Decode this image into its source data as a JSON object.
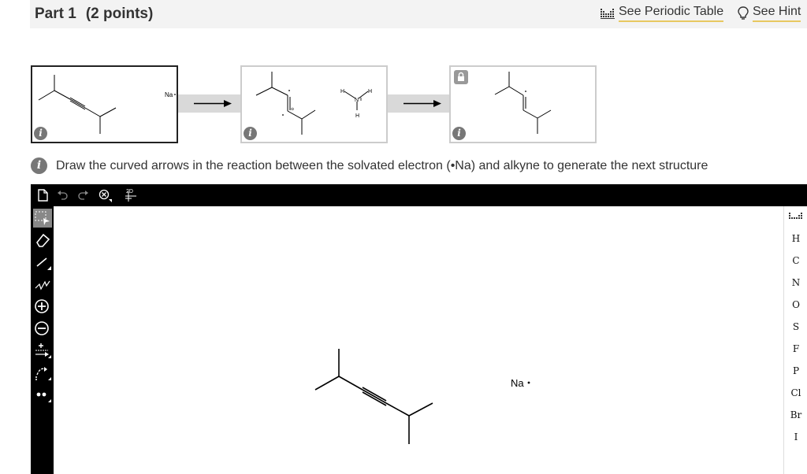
{
  "header": {
    "part": "Part 1",
    "points": "(2 points)",
    "periodic_table_link": "See Periodic Table",
    "hint_link": "See Hint"
  },
  "scheme": {
    "box1": {
      "sodium_label": "Na"
    },
    "box2": {
      "amine_labels": {
        "h_left": "H",
        "n": "N",
        "h_right": "H",
        "h_bottom": "H"
      }
    },
    "info_glyph": "i"
  },
  "instruction": {
    "text": "Draw the curved arrows in the reaction between the solvated electron (•Na) and alkyne to generate the next structure"
  },
  "editor": {
    "topbar_icons": [
      "new-document-icon",
      "undo-icon",
      "redo-icon",
      "clear-icon",
      "2d-clean-icon"
    ],
    "clean_label": "2D",
    "left_tools": [
      "select-icon",
      "eraser-icon",
      "bond-icon",
      "chain-icon",
      "positive-charge-icon",
      "negative-charge-icon",
      "charge-arrow-icon",
      "curved-arrow-icon",
      "lone-pair-icon"
    ],
    "canvas": {
      "sodium_label": "Na"
    },
    "elements": [
      "H",
      "C",
      "N",
      "O",
      "S",
      "F",
      "P",
      "Cl",
      "Br",
      "I"
    ]
  },
  "colors": {
    "editor_bg": "#000000",
    "header_bg": "#f3f3f3",
    "link_underline": "#e8c860",
    "connector": "#d9d9d9"
  }
}
